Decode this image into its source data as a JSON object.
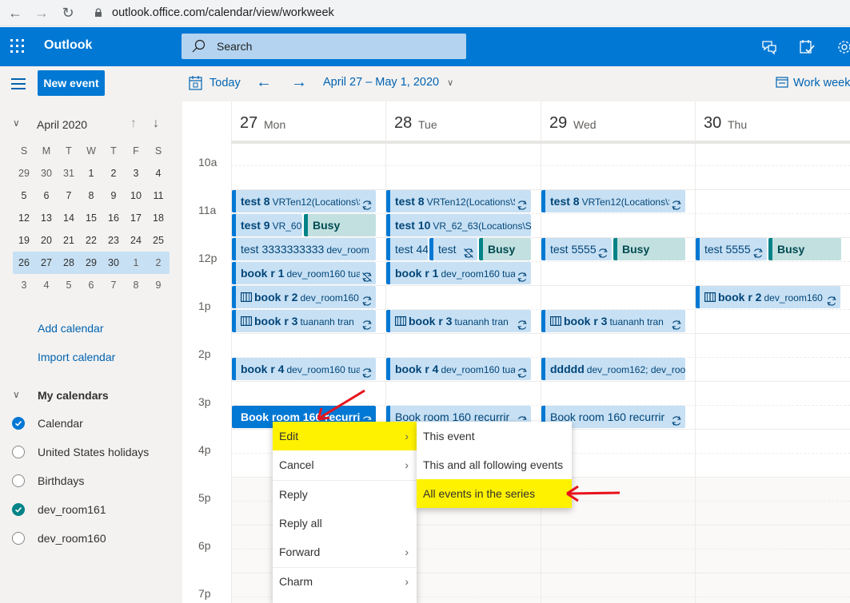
{
  "browser": {
    "url": "outlook.office.com/calendar/view/workweek",
    "back_icon": "arrow-left-icon",
    "forward_icon": "arrow-right-icon",
    "reload_icon": "reload-icon"
  },
  "header": {
    "app_name": "Outlook",
    "search_placeholder": "Search",
    "icons": [
      "app-launcher-icon",
      "chat-icon",
      "calendar-check-icon",
      "gear-icon"
    ],
    "brand_color": "#0078d4"
  },
  "toolbar": {
    "new_event_label": "New event",
    "today_label": "Today",
    "date_range": "April 27 – May 1, 2020",
    "view_label": "Work week"
  },
  "mini_calendar": {
    "month_label": "April 2020",
    "weekdays": [
      "S",
      "M",
      "T",
      "W",
      "T",
      "F",
      "S"
    ],
    "weeks": [
      [
        "29",
        "30",
        "31",
        "1",
        "2",
        "3",
        "4"
      ],
      [
        "5",
        "6",
        "7",
        "8",
        "9",
        "10",
        "11"
      ],
      [
        "12",
        "13",
        "14",
        "15",
        "16",
        "17",
        "18"
      ],
      [
        "19",
        "20",
        "21",
        "22",
        "23",
        "24",
        "25"
      ],
      [
        "26",
        "27",
        "28",
        "29",
        "30",
        "1",
        "2"
      ],
      [
        "3",
        "4",
        "5",
        "6",
        "7",
        "8",
        "9"
      ]
    ],
    "selected_week_index": 4
  },
  "sidebar": {
    "add_calendar": "Add calendar",
    "import_calendar": "Import calendar",
    "my_calendars_label": "My calendars",
    "calendars": [
      {
        "name": "Calendar",
        "checked": true,
        "color": "#0078d4"
      },
      {
        "name": "United States holidays",
        "checked": false,
        "color": ""
      },
      {
        "name": "Birthdays",
        "checked": false,
        "color": ""
      },
      {
        "name": "dev_room161",
        "checked": true,
        "color": "#038387"
      },
      {
        "name": "dev_room160",
        "checked": false,
        "color": ""
      }
    ]
  },
  "calendar": {
    "days": [
      {
        "num": "27",
        "name": "Mon"
      },
      {
        "num": "28",
        "name": "Tue"
      },
      {
        "num": "29",
        "name": "Wed"
      },
      {
        "num": "30",
        "name": "Thu"
      }
    ],
    "time_labels": [
      "10a",
      "11a",
      "12p",
      "1p",
      "2p",
      "3p",
      "4p",
      "5p",
      "6p",
      "7p"
    ],
    "events": [
      {
        "day": 0,
        "start": "11:00",
        "title": "test 8",
        "location": "VRTen12(Locations\\S",
        "icon": "recurring-icon"
      },
      {
        "day": 1,
        "start": "11:00",
        "title": "test 8",
        "location": "VRTen12(Locations\\S",
        "icon": "recurring-icon"
      },
      {
        "day": 2,
        "start": "11:00",
        "title": "test 8",
        "location": "VRTen12(Locations\\S",
        "icon": "recurring-icon"
      },
      {
        "day": 0,
        "start": "11:30",
        "title": "test 9",
        "location": "VR_60",
        "icon": ""
      },
      {
        "day": 0,
        "start": "11:30",
        "title": "Busy",
        "location": "",
        "icon": "",
        "busy": true
      },
      {
        "day": 1,
        "start": "11:30",
        "title": "test 10",
        "location": "VR_62_63(Locations\\S",
        "icon": ""
      },
      {
        "day": 0,
        "start": "12:00",
        "title": "test 3333333333",
        "location": "dev_room",
        "icon": "",
        "regular": true
      },
      {
        "day": 1,
        "start": "12:00",
        "title": "test 44",
        "location": "",
        "icon": "",
        "regular": true
      },
      {
        "day": 1,
        "start": "12:00",
        "title": "test",
        "location": "",
        "icon": "recurring-exception-icon",
        "regular": true
      },
      {
        "day": 1,
        "start": "12:00",
        "title": "Busy",
        "location": "",
        "icon": "",
        "busy": true
      },
      {
        "day": 2,
        "start": "12:00",
        "title": "test 5555",
        "location": "",
        "icon": "recurring-icon",
        "regular": true
      },
      {
        "day": 2,
        "start": "12:00",
        "title": "Busy",
        "location": "",
        "icon": "",
        "busy": true
      },
      {
        "day": 3,
        "start": "12:00",
        "title": "test 5555",
        "location": "",
        "icon": "recurring-icon",
        "regular": true
      },
      {
        "day": 3,
        "start": "12:00",
        "title": "Busy",
        "location": "",
        "icon": "",
        "busy": true
      },
      {
        "day": 0,
        "start": "12:30",
        "title": "book r 1",
        "location": "dev_room160 tua",
        "icon": "recurring-exception-icon"
      },
      {
        "day": 1,
        "start": "12:30",
        "title": "book r 1",
        "location": "dev_room160 tua",
        "icon": "recurring-icon"
      },
      {
        "day": 0,
        "start": "13:00",
        "title": "book r 2",
        "location": "dev_room160",
        "icon": "recurring-icon",
        "book": true
      },
      {
        "day": 3,
        "start": "13:00",
        "title": "book r 2",
        "location": "dev_room160",
        "icon": "recurring-icon",
        "book": true
      },
      {
        "day": 0,
        "start": "13:30",
        "title": "book r 3",
        "location": "tuananh tran",
        "icon": "recurring-icon",
        "book": true
      },
      {
        "day": 1,
        "start": "13:30",
        "title": "book r 3",
        "location": "tuananh tran",
        "icon": "recurring-icon",
        "book": true
      },
      {
        "day": 2,
        "start": "13:30",
        "title": "book r 3",
        "location": "tuananh tran",
        "icon": "recurring-icon",
        "book": true
      },
      {
        "day": 0,
        "start": "14:30",
        "title": "book r 4",
        "location": "dev_room160 tua",
        "icon": "recurring-icon"
      },
      {
        "day": 1,
        "start": "14:30",
        "title": "book r 4",
        "location": "dev_room160 tua",
        "icon": "recurring-icon"
      },
      {
        "day": 2,
        "start": "14:30",
        "title": "ddddd",
        "location": "dev_room162; dev_roo",
        "icon": ""
      },
      {
        "day": 0,
        "start": "15:30",
        "title": "Book room 160 recurrir",
        "location": "",
        "icon": "recurring-icon",
        "active": true
      },
      {
        "day": 1,
        "start": "15:30",
        "title": "Book room 160 recurrir",
        "location": "",
        "icon": "recurring-icon",
        "regular": true
      },
      {
        "day": 2,
        "start": "15:30",
        "title": "Book room 160 recurrir",
        "location": "",
        "icon": "recurring-icon",
        "regular": true
      }
    ]
  },
  "context_menu": {
    "items": [
      {
        "label": "Edit",
        "submenu": true,
        "highlighted": true
      },
      {
        "label": "Cancel",
        "submenu": true
      },
      {
        "label": "Reply",
        "submenu": false
      },
      {
        "label": "Reply all",
        "submenu": false
      },
      {
        "label": "Forward",
        "submenu": true
      },
      {
        "label": "Charm",
        "submenu": true
      }
    ],
    "submenu": [
      {
        "label": "This event"
      },
      {
        "label": "This and all following events"
      },
      {
        "label": "All events in the series",
        "highlighted": true
      }
    ],
    "highlight_color": "#fff200"
  }
}
